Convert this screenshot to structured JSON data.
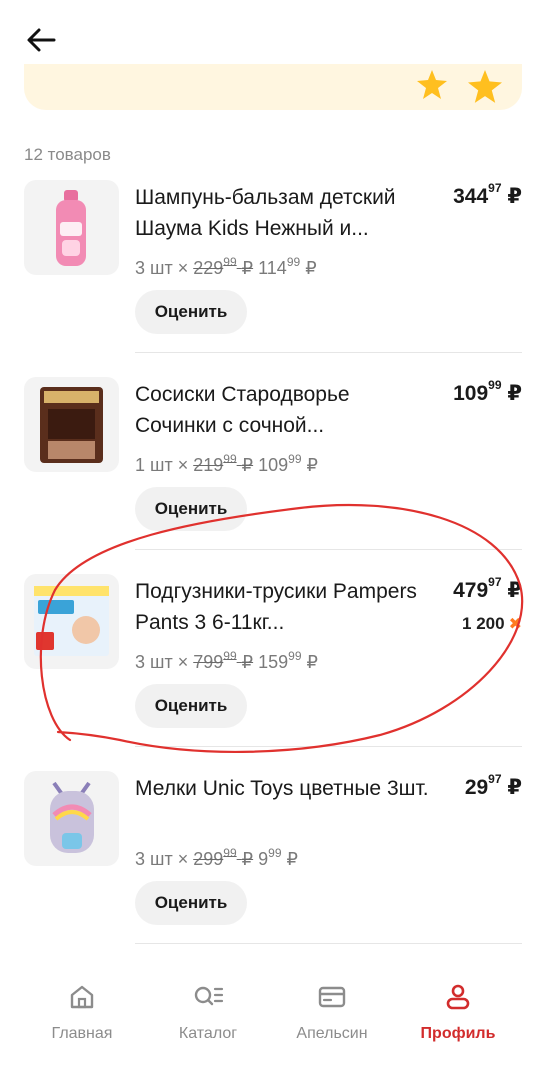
{
  "header": {
    "back_icon": "arrow-left-icon"
  },
  "banner": {
    "icon": "star-icon",
    "color": "#fff6e0"
  },
  "order": {
    "count_label": "12 товаров",
    "items": [
      {
        "name": "Шампунь-бальзам детский Шаума Kids Нежный и...",
        "price_int": "344",
        "price_frac": "97",
        "currency": "₽",
        "qty": "3 шт ×",
        "old_int": "229",
        "old_frac": "99",
        "new_int": "114",
        "new_frac": "99",
        "rate_label": "Оценить"
      },
      {
        "name": "Сосиски Стародворье Сочинки с сочной...",
        "price_int": "109",
        "price_frac": "99",
        "currency": "₽",
        "qty": "1 шт ×",
        "old_int": "219",
        "old_frac": "99",
        "new_int": "109",
        "new_frac": "99",
        "rate_label": "Оценить"
      },
      {
        "name": "Подгузники-трусики Pampers Pants 3 6-11кг...",
        "price_int": "479",
        "price_frac": "97",
        "currency": "₽",
        "bonus": "1 200",
        "qty": "3 шт ×",
        "old_int": "799",
        "old_frac": "99",
        "new_int": "159",
        "new_frac": "99",
        "rate_label": "Оценить"
      },
      {
        "name": "Мелки Unic Toys цветные 3шт.",
        "price_int": "29",
        "price_frac": "97",
        "currency": "₽",
        "qty": "3 шт ×",
        "old_int": "299",
        "old_frac": "99",
        "new_int": "9",
        "new_frac": "99",
        "rate_label": "Оценить"
      }
    ]
  },
  "tabbar": {
    "tabs": [
      {
        "label": "Главная",
        "icon": "home-icon"
      },
      {
        "label": "Каталог",
        "icon": "catalog-search-icon"
      },
      {
        "label": "Апельсин",
        "icon": "card-icon"
      },
      {
        "label": "Профиль",
        "icon": "profile-icon",
        "active": true
      }
    ],
    "active_color": "#d22c2c"
  },
  "annotation": {
    "color": "#e0312e"
  }
}
